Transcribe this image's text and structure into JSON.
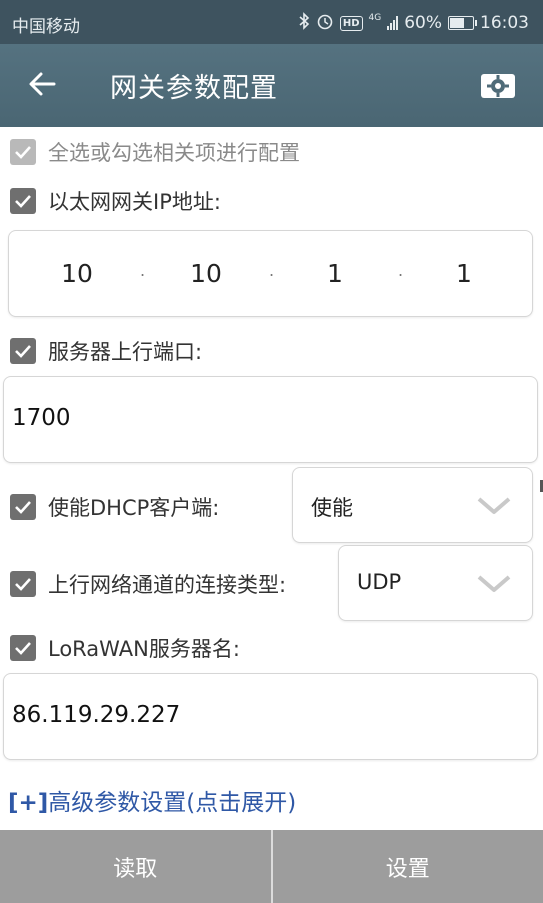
{
  "status_bar": {
    "carrier": "中国移动",
    "hd": "HD",
    "network": "4G",
    "battery": "60%",
    "time": "16:03"
  },
  "toolbar": {
    "title": "网关参数配置"
  },
  "form": {
    "select_all_label": "全选或勾选相关项进行配置",
    "ip_label": "以太网网关IP地址:",
    "ip_parts": [
      "10",
      "10",
      "1",
      "1"
    ],
    "ip_separator": ".",
    "port_label": "服务器上行端口:",
    "port_value": "1700",
    "dhcp_label": "使能DHCP客户端:",
    "dhcp_value": "使能",
    "conn_label": "上行网络通道的连接类型:",
    "conn_value": "UDP",
    "server_label": "LoRaWAN服务器名:",
    "server_value": "86.119.29.227"
  },
  "advanced": {
    "bracket": "[+]",
    "label": "高级参数设置(点击展开)"
  },
  "buttons": {
    "read": "读取",
    "set": "设置"
  },
  "colors": {
    "status_bar": "#3e535f",
    "toolbar": "#4f6b78",
    "link": "#2f58a6",
    "button": "#9d9d9d"
  }
}
